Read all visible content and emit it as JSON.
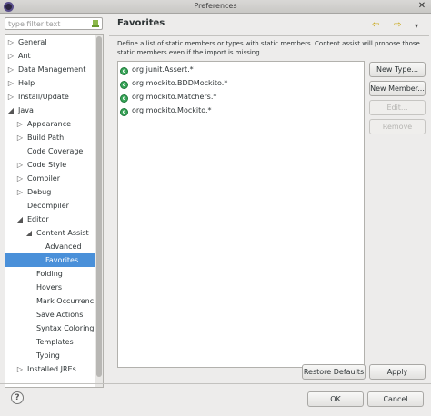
{
  "window": {
    "title": "Preferences",
    "close_glyph": "✕"
  },
  "filter": {
    "placeholder": "type filter text"
  },
  "tree": {
    "items": [
      {
        "label": "General",
        "expander": "▷"
      },
      {
        "label": "Ant",
        "expander": "▷"
      },
      {
        "label": "Data Management",
        "expander": "▷"
      },
      {
        "label": "Help",
        "expander": "▷"
      },
      {
        "label": "Install/Update",
        "expander": "▷"
      },
      {
        "label": "Java",
        "expander": "◢"
      },
      {
        "label": "Appearance",
        "expander": "▷"
      },
      {
        "label": "Build Path",
        "expander": "▷"
      },
      {
        "label": "Code Coverage",
        "expander": ""
      },
      {
        "label": "Code Style",
        "expander": "▷"
      },
      {
        "label": "Compiler",
        "expander": "▷"
      },
      {
        "label": "Debug",
        "expander": "▷"
      },
      {
        "label": "Decompiler",
        "expander": ""
      },
      {
        "label": "Editor",
        "expander": "◢"
      },
      {
        "label": "Content Assist",
        "expander": "◢"
      },
      {
        "label": "Advanced",
        "expander": ""
      },
      {
        "label": "Favorites",
        "expander": "",
        "selected": true
      },
      {
        "label": "Folding",
        "expander": ""
      },
      {
        "label": "Hovers",
        "expander": ""
      },
      {
        "label": "Mark Occurrenc",
        "expander": ""
      },
      {
        "label": "Save Actions",
        "expander": ""
      },
      {
        "label": "Syntax Coloring",
        "expander": ""
      },
      {
        "label": "Templates",
        "expander": ""
      },
      {
        "label": "Typing",
        "expander": ""
      },
      {
        "label": "Installed JREs",
        "expander": "▷"
      }
    ]
  },
  "page": {
    "title": "Favorites",
    "description": "Define a list of static members or types with static members. Content assist will propose those static members even if the import is missing.",
    "nav_back_icon": "⇦",
    "nav_forward_icon": "⇨",
    "nav_menu_icon": "▾",
    "favorites": [
      "org.junit.Assert.*",
      "org.mockito.BDDMockito.*",
      "org.mockito.Matchers.*",
      "org.mockito.Mockito.*"
    ],
    "buttons": {
      "new_type": "New Type...",
      "new_member": "New Member...",
      "edit": "Edit...",
      "remove": "Remove",
      "restore_defaults": "Restore Defaults",
      "apply": "Apply"
    }
  },
  "footer": {
    "help_glyph": "?",
    "ok": "OK",
    "cancel": "Cancel"
  },
  "colors": {
    "selection": "#4a90d9",
    "favorite_icon": "#3aa65a"
  }
}
